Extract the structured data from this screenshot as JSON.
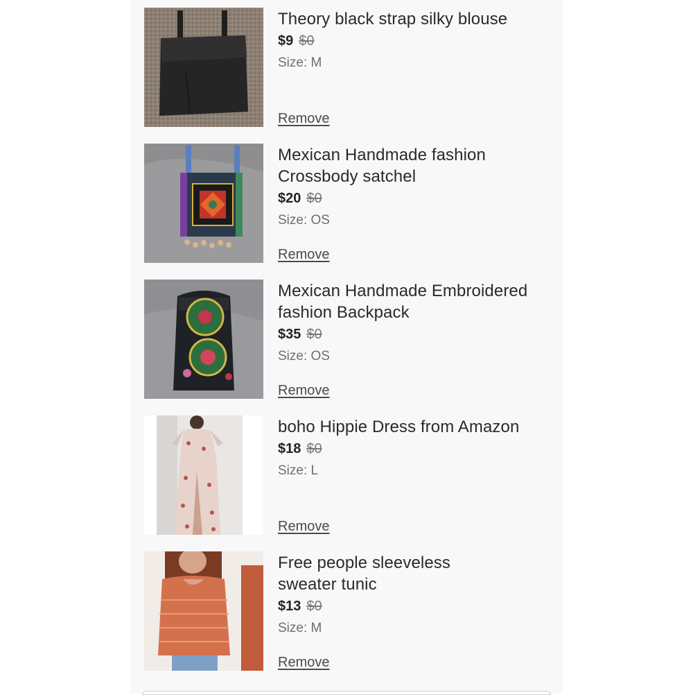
{
  "items": [
    {
      "title": "Theory black strap silky blouse",
      "price": "$9",
      "original_price": "$0",
      "size": "Size: M",
      "remove": "Remove",
      "image": "black-blouse-photo"
    },
    {
      "title": "Mexican Handmade fashion Crossbody satchel",
      "price": "$20",
      "original_price": "$0",
      "size": "Size: OS",
      "remove": "Remove",
      "image": "embroidered-satchel-photo"
    },
    {
      "title": "Mexican Handmade Embroidered fashion Backpack",
      "price": "$35",
      "original_price": "$0",
      "size": "Size: OS",
      "remove": "Remove",
      "image": "embroidered-backpack-photo"
    },
    {
      "title": "boho Hippie Dress from Amazon",
      "price": "$18",
      "original_price": "$0",
      "size": "Size: L",
      "remove": "Remove",
      "image": "floral-dress-photo"
    },
    {
      "title": "Free people sleeveless sweater tunic",
      "price": "$13",
      "original_price": "$0",
      "size": "Size: M",
      "remove": "Remove",
      "image": "knit-tunic-photo"
    }
  ]
}
